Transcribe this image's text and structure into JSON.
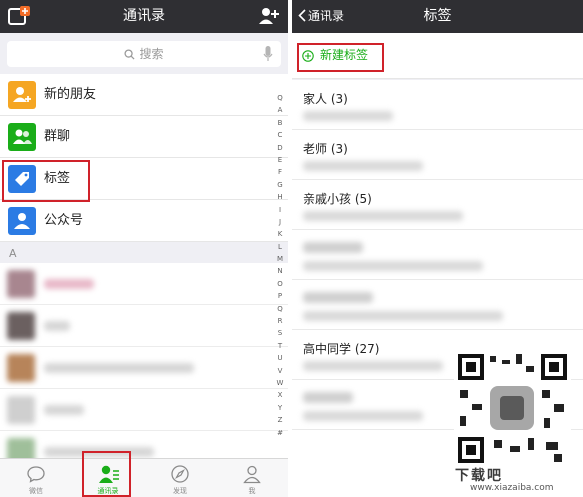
{
  "left_screen": {
    "title": "通讯录",
    "search_placeholder": "搜索",
    "menu": [
      {
        "label": "新的朋友",
        "icon": "new-friend-icon",
        "color": "#f5a623"
      },
      {
        "label": "群聊",
        "icon": "group-chat-icon",
        "color": "#1aad19"
      },
      {
        "label": "标签",
        "icon": "tag-icon",
        "color": "#2b7be4"
      },
      {
        "label": "公众号",
        "icon": "official-account-icon",
        "color": "#2b7be4"
      }
    ],
    "section_letter": "A",
    "index_letters": [
      "Q",
      "A",
      "B",
      "C",
      "D",
      "E",
      "F",
      "G",
      "H",
      "I",
      "J",
      "K",
      "L",
      "M",
      "N",
      "O",
      "P",
      "Q",
      "R",
      "S",
      "T",
      "U",
      "V",
      "W",
      "X",
      "Y",
      "Z",
      "#"
    ],
    "tabs": [
      {
        "label": "微信",
        "icon": "chat-bubble-icon"
      },
      {
        "label": "通讯录",
        "icon": "contacts-icon",
        "active": true
      },
      {
        "label": "发现",
        "icon": "compass-icon"
      },
      {
        "label": "我",
        "icon": "person-icon"
      }
    ]
  },
  "right_screen": {
    "back_label": "通讯录",
    "title": "标签",
    "new_tag_label": "新建标签",
    "tags": [
      {
        "name": "家人 (3)"
      },
      {
        "name": "老师 (3)"
      },
      {
        "name": "亲戚小孩 (5)"
      },
      {
        "name": ""
      },
      {
        "name": ""
      },
      {
        "name": "高中同学 (27)"
      },
      {
        "name": ""
      }
    ]
  },
  "watermark": {
    "text": "www.xiazaiba.com"
  },
  "colors": {
    "nav_bg": "#2f2f33",
    "accent_green": "#1aad19",
    "highlight_red": "#d0222a",
    "page_bg": "#efeff4"
  }
}
